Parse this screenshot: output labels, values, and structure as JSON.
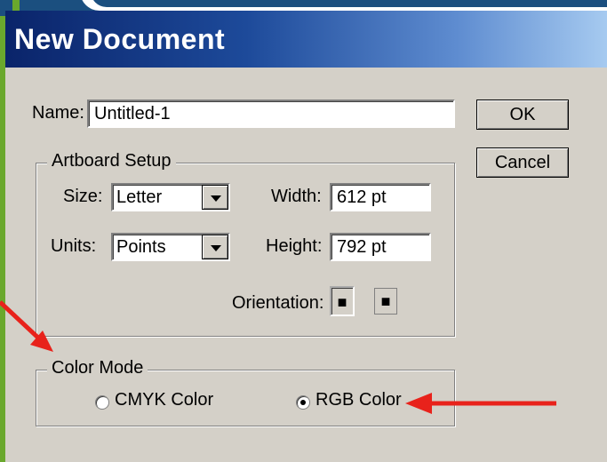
{
  "window": {
    "title": "New Document"
  },
  "name": {
    "label": "Name:",
    "value": "Untitled-1"
  },
  "buttons": {
    "ok": "OK",
    "cancel": "Cancel"
  },
  "artboard": {
    "group_label": "Artboard Setup",
    "size_label": "Size:",
    "size_value": "Letter",
    "units_label": "Units:",
    "units_value": "Points",
    "width_label": "Width:",
    "width_value": "612 pt",
    "height_label": "Height:",
    "height_value": "792 pt",
    "orientation_label": "Orientation:"
  },
  "color_mode": {
    "group_label": "Color Mode",
    "options": [
      "CMYK Color",
      "RGB Color"
    ],
    "selected": "RGB Color"
  },
  "annotation_color": "#e8221b",
  "icons": [
    "portrait-orientation-icon",
    "landscape-orientation-icon",
    "chevron-down-icon"
  ]
}
